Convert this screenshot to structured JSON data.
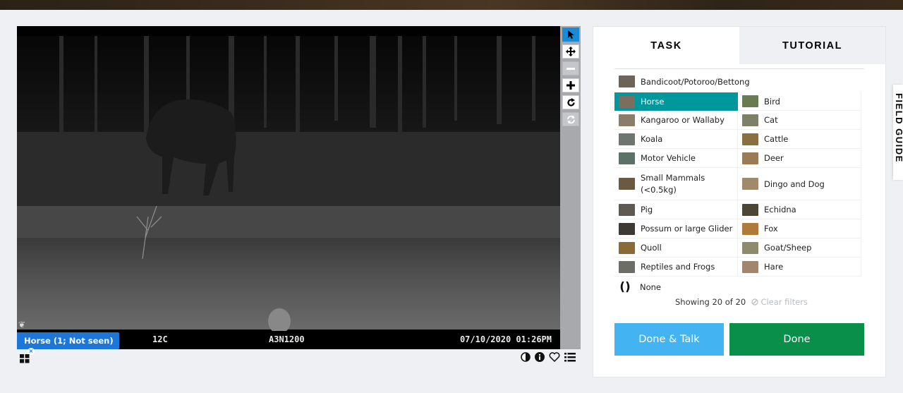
{
  "viewer": {
    "imprint": {
      "temperature": "12C",
      "camera_id": "A3N1200",
      "timestamp": "07/10/2020 01:26PM"
    },
    "annotation_tag": "Horse (1; Not seen)"
  },
  "tools": [
    "pointer-icon",
    "move-icon",
    "zoom-out-icon",
    "zoom-in-icon",
    "rotate-icon",
    "reset-icon"
  ],
  "tabs": {
    "task": "TASK",
    "tutorial": "TUTORIAL"
  },
  "choices": {
    "top": {
      "label": "Bandicoot/Potoroo/Bettong",
      "thumb": "#6d6356"
    },
    "left": [
      {
        "label": "Horse",
        "thumb": "#7c6e5e",
        "selected": true
      },
      {
        "label": "Kangaroo or Wallaby",
        "thumb": "#8a7d6a"
      },
      {
        "label": "Koala",
        "thumb": "#6f7670"
      },
      {
        "label": "Motor Vehicle",
        "thumb": "#5c7168"
      },
      {
        "label": "Small Mammals (<0.5kg)",
        "thumb": "#6b5a40"
      },
      {
        "label": "Pig",
        "thumb": "#5e5a52"
      },
      {
        "label": "Possum or large Glider",
        "thumb": "#3d3a35"
      },
      {
        "label": "Quoll",
        "thumb": "#8b6a3a"
      },
      {
        "label": "Reptiles and Frogs",
        "thumb": "#6b6d66"
      }
    ],
    "right": [
      {
        "label": "Bird",
        "thumb": "#6a7a52"
      },
      {
        "label": "Cat",
        "thumb": "#7f8068"
      },
      {
        "label": "Cattle",
        "thumb": "#8a6f42"
      },
      {
        "label": "Deer",
        "thumb": "#9a7b55"
      },
      {
        "label": "Dingo and Dog",
        "thumb": "#a08a6c"
      },
      {
        "label": "Echidna",
        "thumb": "#4b4636"
      },
      {
        "label": "Fox",
        "thumb": "#b07a3a"
      },
      {
        "label": "Goat/Sheep",
        "thumb": "#8d8a6e"
      },
      {
        "label": "Hare",
        "thumb": "#a08670"
      }
    ],
    "none": {
      "label": "None",
      "symbol": "()"
    },
    "showing": "Showing 20 of 20",
    "clear_filters": "Clear filters"
  },
  "buttons": {
    "done_talk": "Done & Talk",
    "done": "Done"
  },
  "field_guide": "FIELD GUIDE",
  "colors": {
    "selected": "#00979d",
    "done": "#0a8f4a",
    "done_talk": "#43b4f1",
    "active_tool": "#1a8ad6",
    "tag": "#1d77d8"
  }
}
